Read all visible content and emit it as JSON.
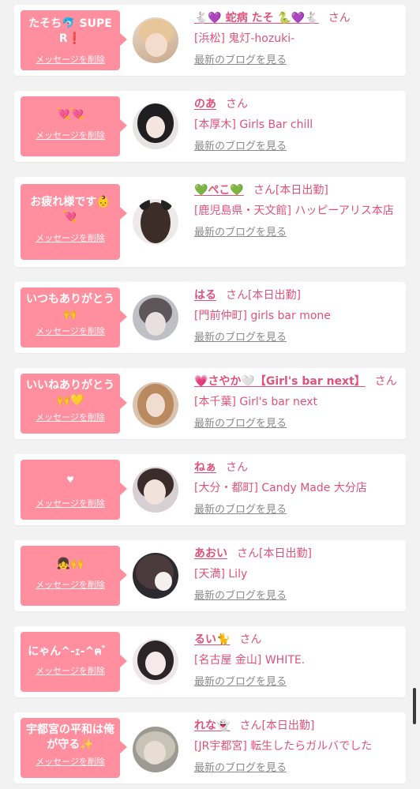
{
  "theme": {
    "bubble_color": "#ff8f9f",
    "link_color": "#e0527a",
    "background": "#f2f2f2"
  },
  "items": [
    {
      "message": "たそち🐬 SUPER❗",
      "delete_label": "メッセージを削除",
      "name": "🐇💜 蛇病 たそ 🐍💜🐇",
      "san": "さん",
      "status": "",
      "shop": "[浜松] 鬼灯-hozuki-",
      "blog_label": "最新のブログを見る"
    },
    {
      "message": "💘💘",
      "delete_label": "メッセージを削除",
      "name": "のあ",
      "san": "さん",
      "status": "",
      "shop": "[本厚木] Girls Bar chill",
      "blog_label": "最新のブログを見る"
    },
    {
      "message": "お疲れ様です👶 💘",
      "delete_label": "メッセージを削除",
      "name": "💚ぺこ💚",
      "san": "さん",
      "status": "[本日出勤]",
      "shop": "[鹿児島県・天文館] ハッピーアリス本店",
      "blog_label": "最新のブログを見る"
    },
    {
      "message": "いつもありがとう🙌",
      "delete_label": "メッセージを削除",
      "name": "はる",
      "san": "さん",
      "status": "[本日出勤]",
      "shop": "[門前仲町] girls bar mone",
      "blog_label": "最新のブログを見る"
    },
    {
      "message": "いいねありがとう🙌💛",
      "delete_label": "メッセージを削除",
      "name": "💗さやか🤍【Girl's bar next】",
      "san": "さん",
      "status": "",
      "shop": "[本千葉] Girl's bar next",
      "blog_label": "最新のブログを見る"
    },
    {
      "message": "♥",
      "delete_label": "メッセージを削除",
      "name": "ねぁ",
      "san": "さん",
      "status": "",
      "shop": "[大分・都町] Candy Made 大分店",
      "blog_label": "最新のブログを見る"
    },
    {
      "message": "👧🙌",
      "delete_label": "メッセージを削除",
      "name": "あおい",
      "san": "さん",
      "status": "[本日出勤]",
      "shop": "[天満] Lily",
      "blog_label": "最新のブログを見る"
    },
    {
      "message": "にゃん^-ｪ-^ฅ゛",
      "delete_label": "メッセージを削除",
      "name": "るい🐈",
      "san": "さん",
      "status": "",
      "shop": "[名古屋 金山] WHITE.",
      "blog_label": "最新のブログを見る"
    },
    {
      "message": "宇都宮の平和は俺が守る✨",
      "delete_label": "メッセージを削除",
      "name": "れな👻",
      "san": "さん",
      "status": "[本日出勤]",
      "shop": "[JR宇都宮] 転生したらガルバでした",
      "blog_label": "最新のブログを見る"
    }
  ]
}
